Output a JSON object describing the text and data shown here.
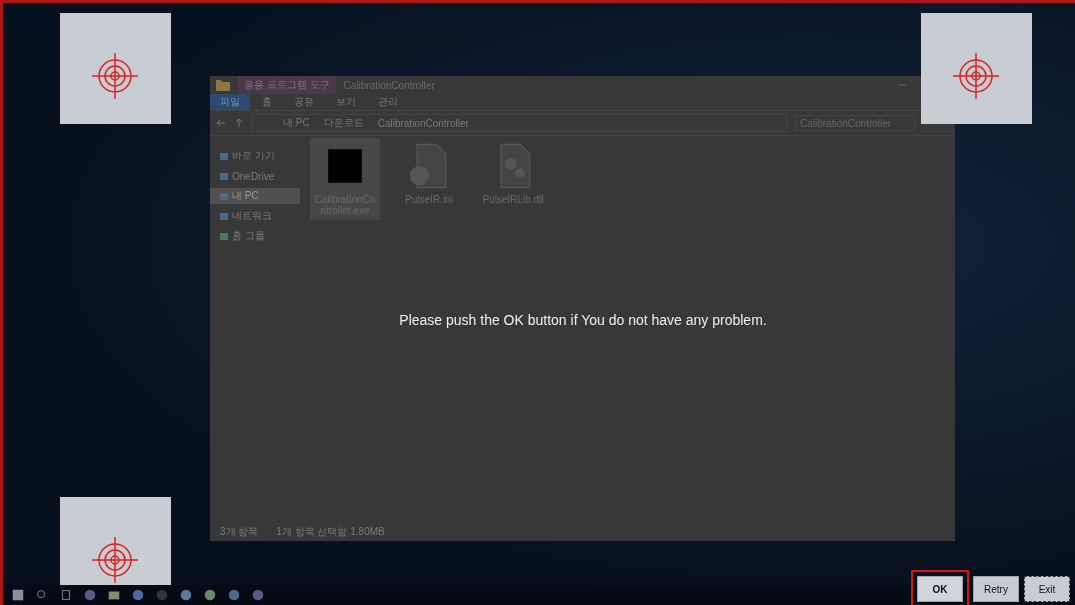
{
  "explorer": {
    "title": "CalibrationController",
    "context_tab": "응용 프로그램 도구",
    "ribbon_tabs": [
      {
        "label": "파일",
        "selected": true
      },
      {
        "label": "홈",
        "selected": false
      },
      {
        "label": "공유",
        "selected": false
      },
      {
        "label": "보기",
        "selected": false
      },
      {
        "label": "관리",
        "selected": false
      }
    ],
    "breadcrumbs": [
      "내 PC",
      "다운로드",
      "CalibrationController"
    ],
    "search": {
      "placeholder": "CalibrationController"
    },
    "sidebar": [
      {
        "label": "바로 가기",
        "kind": "star",
        "selected": false
      },
      {
        "label": "OneDrive",
        "kind": "cloud",
        "selected": false
      },
      {
        "label": "내 PC",
        "kind": "pc",
        "selected": true
      },
      {
        "label": "네트워크",
        "kind": "network",
        "selected": false
      },
      {
        "label": "홈 그룹",
        "kind": "homegroup",
        "selected": false
      }
    ],
    "files": [
      {
        "name": "CalibrationController.exe",
        "kind": "exe",
        "selected": true
      },
      {
        "name": "PulseIR.ini",
        "kind": "ini",
        "selected": false
      },
      {
        "name": "PulseIRLib.dll",
        "kind": "dll",
        "selected": false
      }
    ],
    "status": [
      "3개 항목",
      "1개 항목 선택함 1.80MB"
    ]
  },
  "message": "Please push the OK button if You do not have any problem.",
  "buttons": [
    {
      "label": "OK",
      "selected": true,
      "focused": false
    },
    {
      "label": "Retry",
      "selected": false,
      "focused": false
    },
    {
      "label": "Exit",
      "selected": false,
      "focused": true
    }
  ]
}
